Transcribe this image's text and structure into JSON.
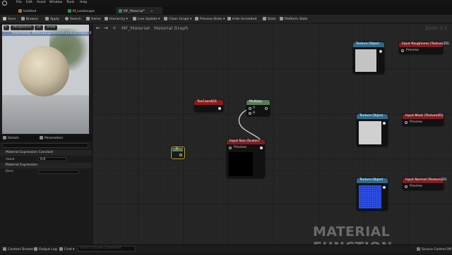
{
  "menu": {
    "items": [
      "File",
      "Edit",
      "Asset",
      "Window",
      "Tools",
      "Help"
    ]
  },
  "tabs": [
    {
      "label": "Untitled"
    },
    {
      "label": "M_Landscape"
    },
    {
      "label": "MF_Material*"
    }
  ],
  "toolbar": {
    "save": "Save",
    "browse": "Browse",
    "apply": "Apply",
    "search": "Search",
    "home": "Home",
    "hierarchy": "Hierarchy",
    "live_update": "Live Update",
    "clean_graph": "Clean Graph",
    "preview_state": "Preview State",
    "hide_unrelated": "Hide Unrelated",
    "stats": "Stats",
    "platform_stats": "Platform Stats"
  },
  "viewport": {
    "perspective": "Perspective",
    "lit": "Lit",
    "show": "Show",
    "message": "Previewing: MaterialExpressionFunctionOutput_0"
  },
  "panel": {
    "tab_details": "Details",
    "tab_parameters": "Parameters",
    "section_constant": "Material Expression Constant",
    "value_label": "Value",
    "value": "0.0",
    "section_expression": "Material Expression",
    "desc_label": "Desc"
  },
  "graph": {
    "breadcrumb_root": "MF_Material",
    "breadcrumb_leaf": "Material Graph",
    "zoom": "Zoom 1:1",
    "watermark": "MATERIAL FUNCTION"
  },
  "nodes": {
    "texcoord": "TexCoord[0]",
    "multiply": "Multiply",
    "multiply_a": "A",
    "multiply_b": "B",
    "input_size": "Input Size (Scalar)",
    "preview": "Preview",
    "texture_object": "Texture Object",
    "input_roughness": "Input Roughness (Texture2D)",
    "input_mask": "Input Mask (Texture2D)",
    "input_normal": "Input Normal (Texture2D)",
    "constant_value": "0"
  },
  "status": {
    "content_drawer": "Content Drawer",
    "output_log": "Output Log",
    "cmd": "Cmd",
    "cmd_placeholder": "Enter Console Command",
    "source_control": "Source Control Off"
  },
  "colors": {
    "input_header": "#7a1e22",
    "texcoord_header": "#8a1c1c",
    "multiply_header": "#5c7a5a",
    "texobj_header": "#2e6a8c",
    "constant_border": "#c9a12a",
    "normal_fill": "#1e3fd0"
  }
}
